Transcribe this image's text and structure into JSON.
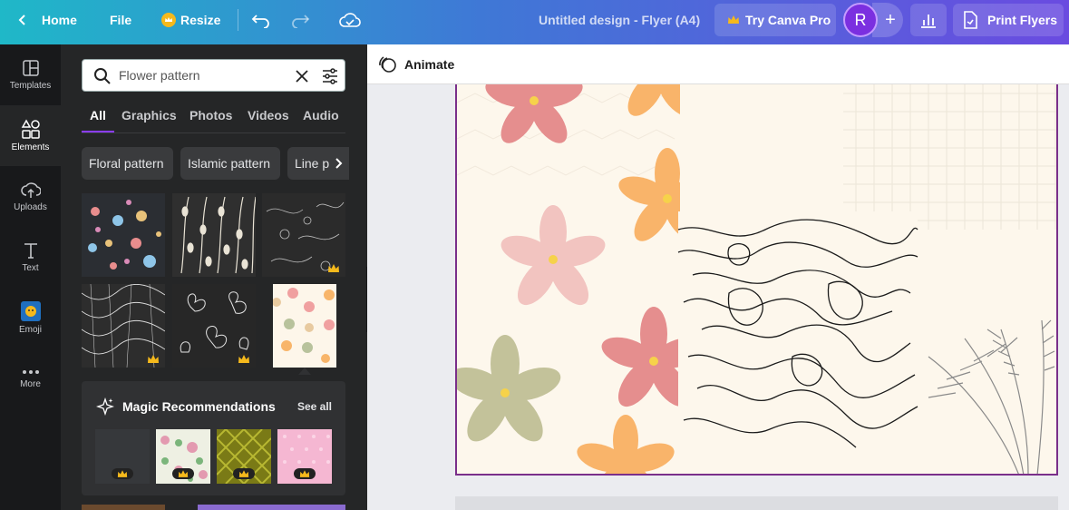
{
  "topbar": {
    "home_label": "Home",
    "file_label": "File",
    "resize_label": "Resize",
    "design_title": "Untitled design - Flyer (A4)",
    "try_pro_label": "Try Canva Pro",
    "avatar_letter": "R",
    "plus_symbol": "+",
    "print_label": "Print Flyers",
    "icons": [
      "back-chevron-icon",
      "crown-icon",
      "undo-icon",
      "redo-icon",
      "cloud-saved-icon",
      "analytics-icon",
      "print-icon"
    ]
  },
  "rail": {
    "items": [
      {
        "label": "Templates",
        "icon": "templates-icon"
      },
      {
        "label": "Elements",
        "icon": "elements-icon"
      },
      {
        "label": "Uploads",
        "icon": "upload-cloud-icon"
      },
      {
        "label": "Text",
        "icon": "text-icon"
      },
      {
        "label": "Emoji",
        "icon": "emoji-icon"
      },
      {
        "label": "More",
        "icon": "more-dots-icon"
      }
    ]
  },
  "panel": {
    "search_value": "Flower pattern",
    "tabs": [
      "All",
      "Graphics",
      "Photos",
      "Videos",
      "Audio"
    ],
    "chips": [
      "Floral pattern",
      "Islamic pattern",
      "Line pat"
    ],
    "magic_title": "Magic Recommendations",
    "magic_see_all": "See all"
  },
  "canvas": {
    "animate_label": "Animate"
  },
  "colors": {
    "accent": "#8b3dff",
    "panel_bg": "#252627",
    "rail_bg": "#18191b",
    "page_border": "#7a2f8a",
    "page_bg": "#fdf7ec"
  }
}
